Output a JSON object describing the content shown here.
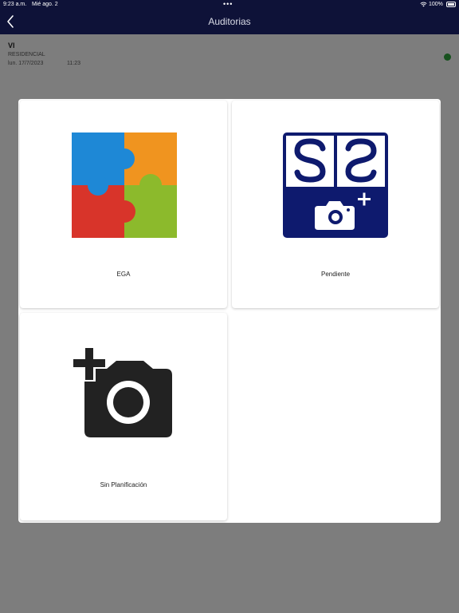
{
  "status": {
    "time": "9:23 a.m.",
    "date": "Mié ago. 2",
    "dots": "•••",
    "battery": "100%"
  },
  "nav": {
    "title": "Auditorias"
  },
  "list": [
    {
      "title": "VI",
      "subtitle": "RESIDENCIAL",
      "date": "lun. 17/7/2023",
      "time": "11:23",
      "status_color": "#2e9e3c"
    }
  ],
  "options": [
    {
      "label": "EGA",
      "icon": "puzzle-icon"
    },
    {
      "label": "Pendiente",
      "icon": "ss-camera-icon"
    },
    {
      "label": "Sin Planificación",
      "icon": "add-camera-icon"
    }
  ],
  "colors": {
    "nav": "#0e1238",
    "status_dot": "#2e9e3c",
    "puzzle": [
      "#1e88d6",
      "#f0941f",
      "#d8342a",
      "#8cba2c"
    ]
  }
}
